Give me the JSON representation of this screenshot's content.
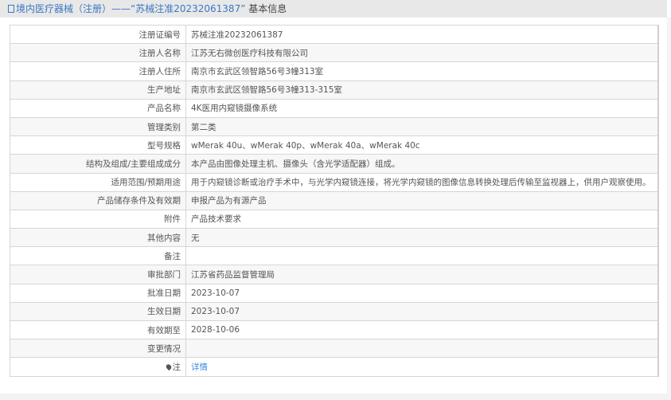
{
  "header": {
    "title": "境内医疗器械（注册）——“苏械注准20232061387”",
    "suffix": " 基本信息"
  },
  "rows": [
    {
      "label": "注册证编号",
      "value": "苏械注准20232061387"
    },
    {
      "label": "注册人名称",
      "value": "江苏无右微创医疗科技有限公司"
    },
    {
      "label": "注册人住所",
      "value": "南京市玄武区领智路56号3幢313室"
    },
    {
      "label": "生产地址",
      "value": "南京市玄武区领智路56号3幢313-315室"
    },
    {
      "label": "产品名称",
      "value": "4K医用内窥镜摄像系统"
    },
    {
      "label": "管理类别",
      "value": "第二类"
    },
    {
      "label": "型号规格",
      "value": "wMerak 40u、wMerak 40p、wMerak 40a、wMerak 40c"
    },
    {
      "label": "结构及组成/主要组成成分",
      "value": "本产品由图像处理主机、摄像头（含光学适配器）组成。"
    },
    {
      "label": "适用范围/预期用途",
      "value": "用于内窥镜诊断或治疗手术中，与光学内窥镜连接，将光学内窥镜的图像信息转换处理后传输至监视器上，供用户观察使用。"
    },
    {
      "label": "产品储存条件及有效期",
      "value": "申报产品为有源产品"
    },
    {
      "label": "附件",
      "value": "产品技术要求"
    },
    {
      "label": "其他内容",
      "value": "无"
    },
    {
      "label": "备注",
      "value": ""
    },
    {
      "label": "审批部门",
      "value": "江苏省药品监督管理局"
    },
    {
      "label": "批准日期",
      "value": "2023-10-07"
    },
    {
      "label": "生效日期",
      "value": "2023-10-07"
    },
    {
      "label": "有效期至",
      "value": "2028-10-06"
    },
    {
      "label": "变更情况",
      "value": ""
    }
  ],
  "note": {
    "label": "注",
    "link": "详情"
  }
}
